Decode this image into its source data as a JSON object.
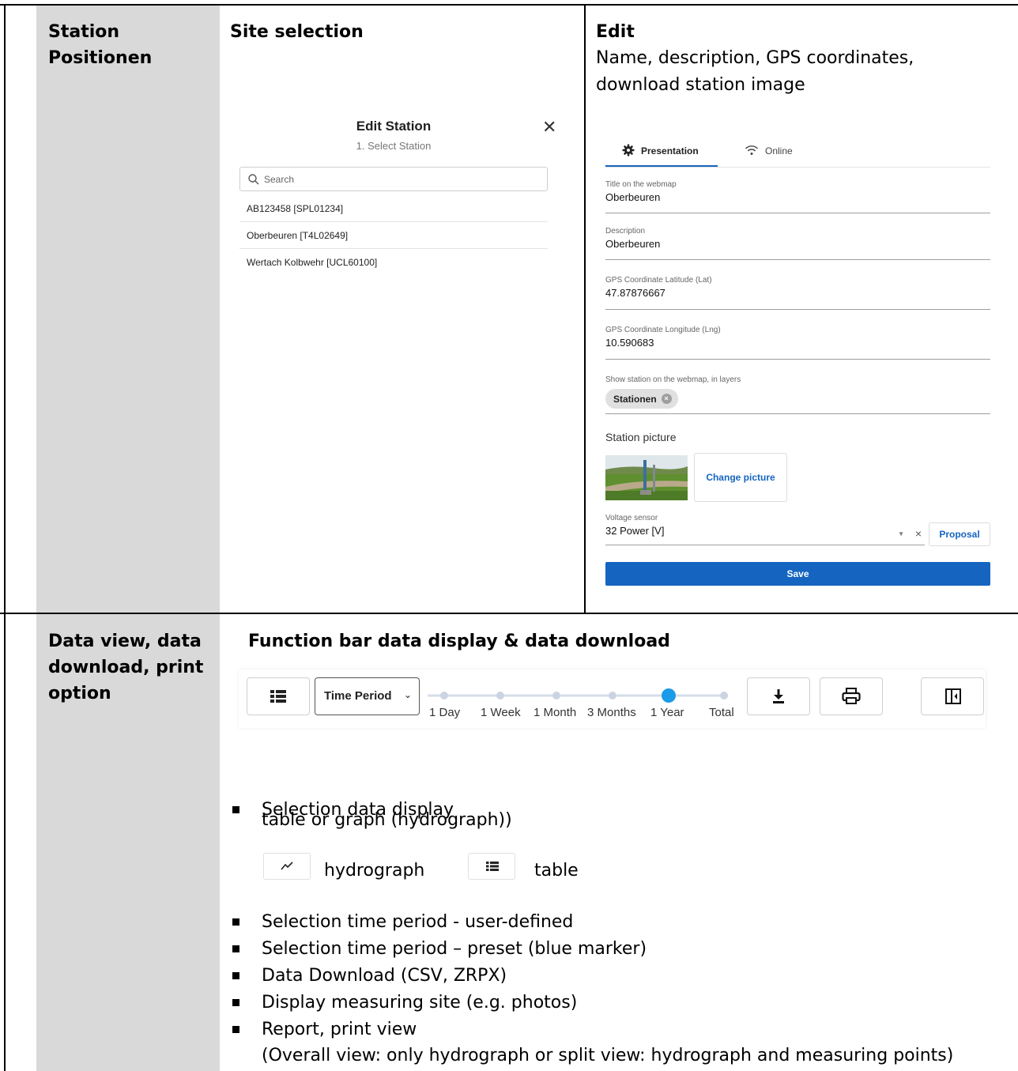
{
  "row1": {
    "left_label": [
      "Station",
      "Positionen"
    ],
    "site_selection": {
      "heading": "Site selection",
      "dialog": {
        "title": "Edit Station",
        "subtitle": "1. Select Station",
        "search_placeholder": "Search",
        "items": [
          "AB123458 [SPL01234]",
          "Oberbeuren [T4L02649]",
          "Wertach Kolbwehr [UCL60100]"
        ]
      }
    },
    "edit": {
      "heading": "Edit",
      "description_lines": [
        "Name, description, GPS coordinates,",
        "download station image"
      ],
      "tabs": [
        "Presentation",
        "Online"
      ],
      "fields": [
        {
          "label": "Title on the webmap",
          "value": "Oberbeuren"
        },
        {
          "label": "Description",
          "value": "Oberbeuren"
        },
        {
          "label": "GPS Coordinate Latitude (Lat)",
          "value": "47.87876667"
        },
        {
          "label": "GPS Coordinate Longitude (Lng)",
          "value": "10.590683"
        }
      ],
      "layers": {
        "label": "Show station on the webmap, in layers",
        "chip": "Stationen"
      },
      "picture": {
        "heading": "Station picture",
        "change_label": "Change picture"
      },
      "voltage": {
        "label": "Voltage sensor",
        "value": "32 Power [V]",
        "proposal_label": "Proposal"
      },
      "save_label": "Save"
    }
  },
  "row2": {
    "left_label": [
      "Data view, data",
      "download, print",
      "option"
    ],
    "heading": "Function bar data display & data download",
    "function_bar": {
      "time_period_label": "Time Period",
      "timeline": {
        "labels": [
          "1 Day",
          "1 Week",
          "1 Month",
          "3 Months",
          "1 Year",
          "Total"
        ],
        "selected_index": 4
      },
      "accent_color": "#1a9be8"
    },
    "bullets": {
      "first_lines": [
        "Selection data display",
        "table or graph (hydrograph))"
      ],
      "hydrograph_label": "hydrograph",
      "table_label": "table",
      "items": [
        "Selection time period - user-defined",
        "Selection time period – preset (blue marker)",
        "Data Download (CSV, ZRPX)",
        "Display measuring site (e.g. photos)",
        "Report, print view"
      ],
      "report_sub": "(Overall view: only hydrograph or split view: hydrograph and measuring points)"
    }
  },
  "colors": {
    "primary_blue": "#1565c0",
    "label_column_grey": "#d9d9d9"
  }
}
